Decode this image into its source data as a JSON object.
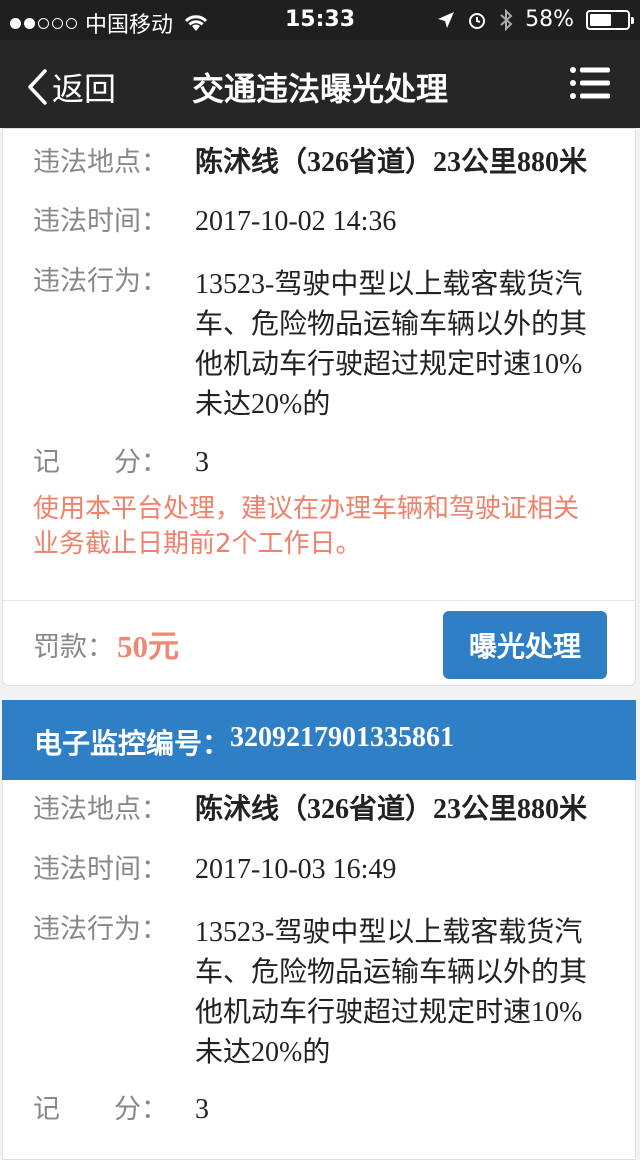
{
  "status_bar": {
    "carrier": "中国移动",
    "time": "15:33",
    "battery": "58%",
    "battery_level": 0.58
  },
  "nav": {
    "back_label": "返回",
    "title": "交通违法曝光处理"
  },
  "labels": {
    "location": "违法地点：",
    "time": "违法时间：",
    "behavior": "违法行为：",
    "points": "记　　分：",
    "fine": "罚款："
  },
  "card1": {
    "location": "陈沭线（326省道）23公里880米",
    "time": "2017-10-02 14:36",
    "behavior": "13523-驾驶中型以上载客载货汽车、危险物品运输车辆以外的其他机动车行驶超过规定时速10%未达20%的",
    "points": "3",
    "notice": "使用本平台处理，建议在办理车辆和驾驶证相关业务截止日期前2个工作日。",
    "fine": "50元",
    "button_label": "曝光处理"
  },
  "card2": {
    "monitor_label": "电子监控编号：",
    "monitor_number": "3209217901335861",
    "location": "陈沭线（326省道）23公里880米",
    "time": "2017-10-03 16:49",
    "behavior": "13523-驾驶中型以上载客载货汽车、危险物品运输车辆以外的其他机动车行驶超过规定时速10%未达20%的",
    "points": "3"
  },
  "colors": {
    "accent": "#2f7fc7",
    "warning": "#f0816a",
    "navbar": "#262626"
  }
}
